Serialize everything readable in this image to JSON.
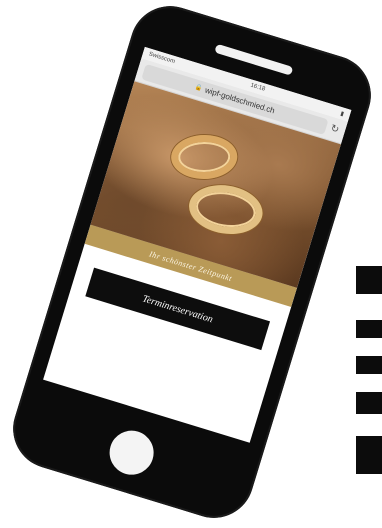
{
  "statusbar": {
    "carrier": "Swisscom",
    "time": "16:18"
  },
  "browser": {
    "url": "wipf-goldschmied.ch",
    "lock_icon": "lock-icon",
    "reload_icon": "reload-icon"
  },
  "hero": {
    "image": "wedding-rings-on-driftwood"
  },
  "banner": {
    "text": "Ihr schönster Zeitpunkt"
  },
  "cta": {
    "label": "Terminreservation"
  },
  "colors": {
    "phone": "#0b0b0b",
    "gold": "#b99a57",
    "button": "#0d0d0d"
  }
}
